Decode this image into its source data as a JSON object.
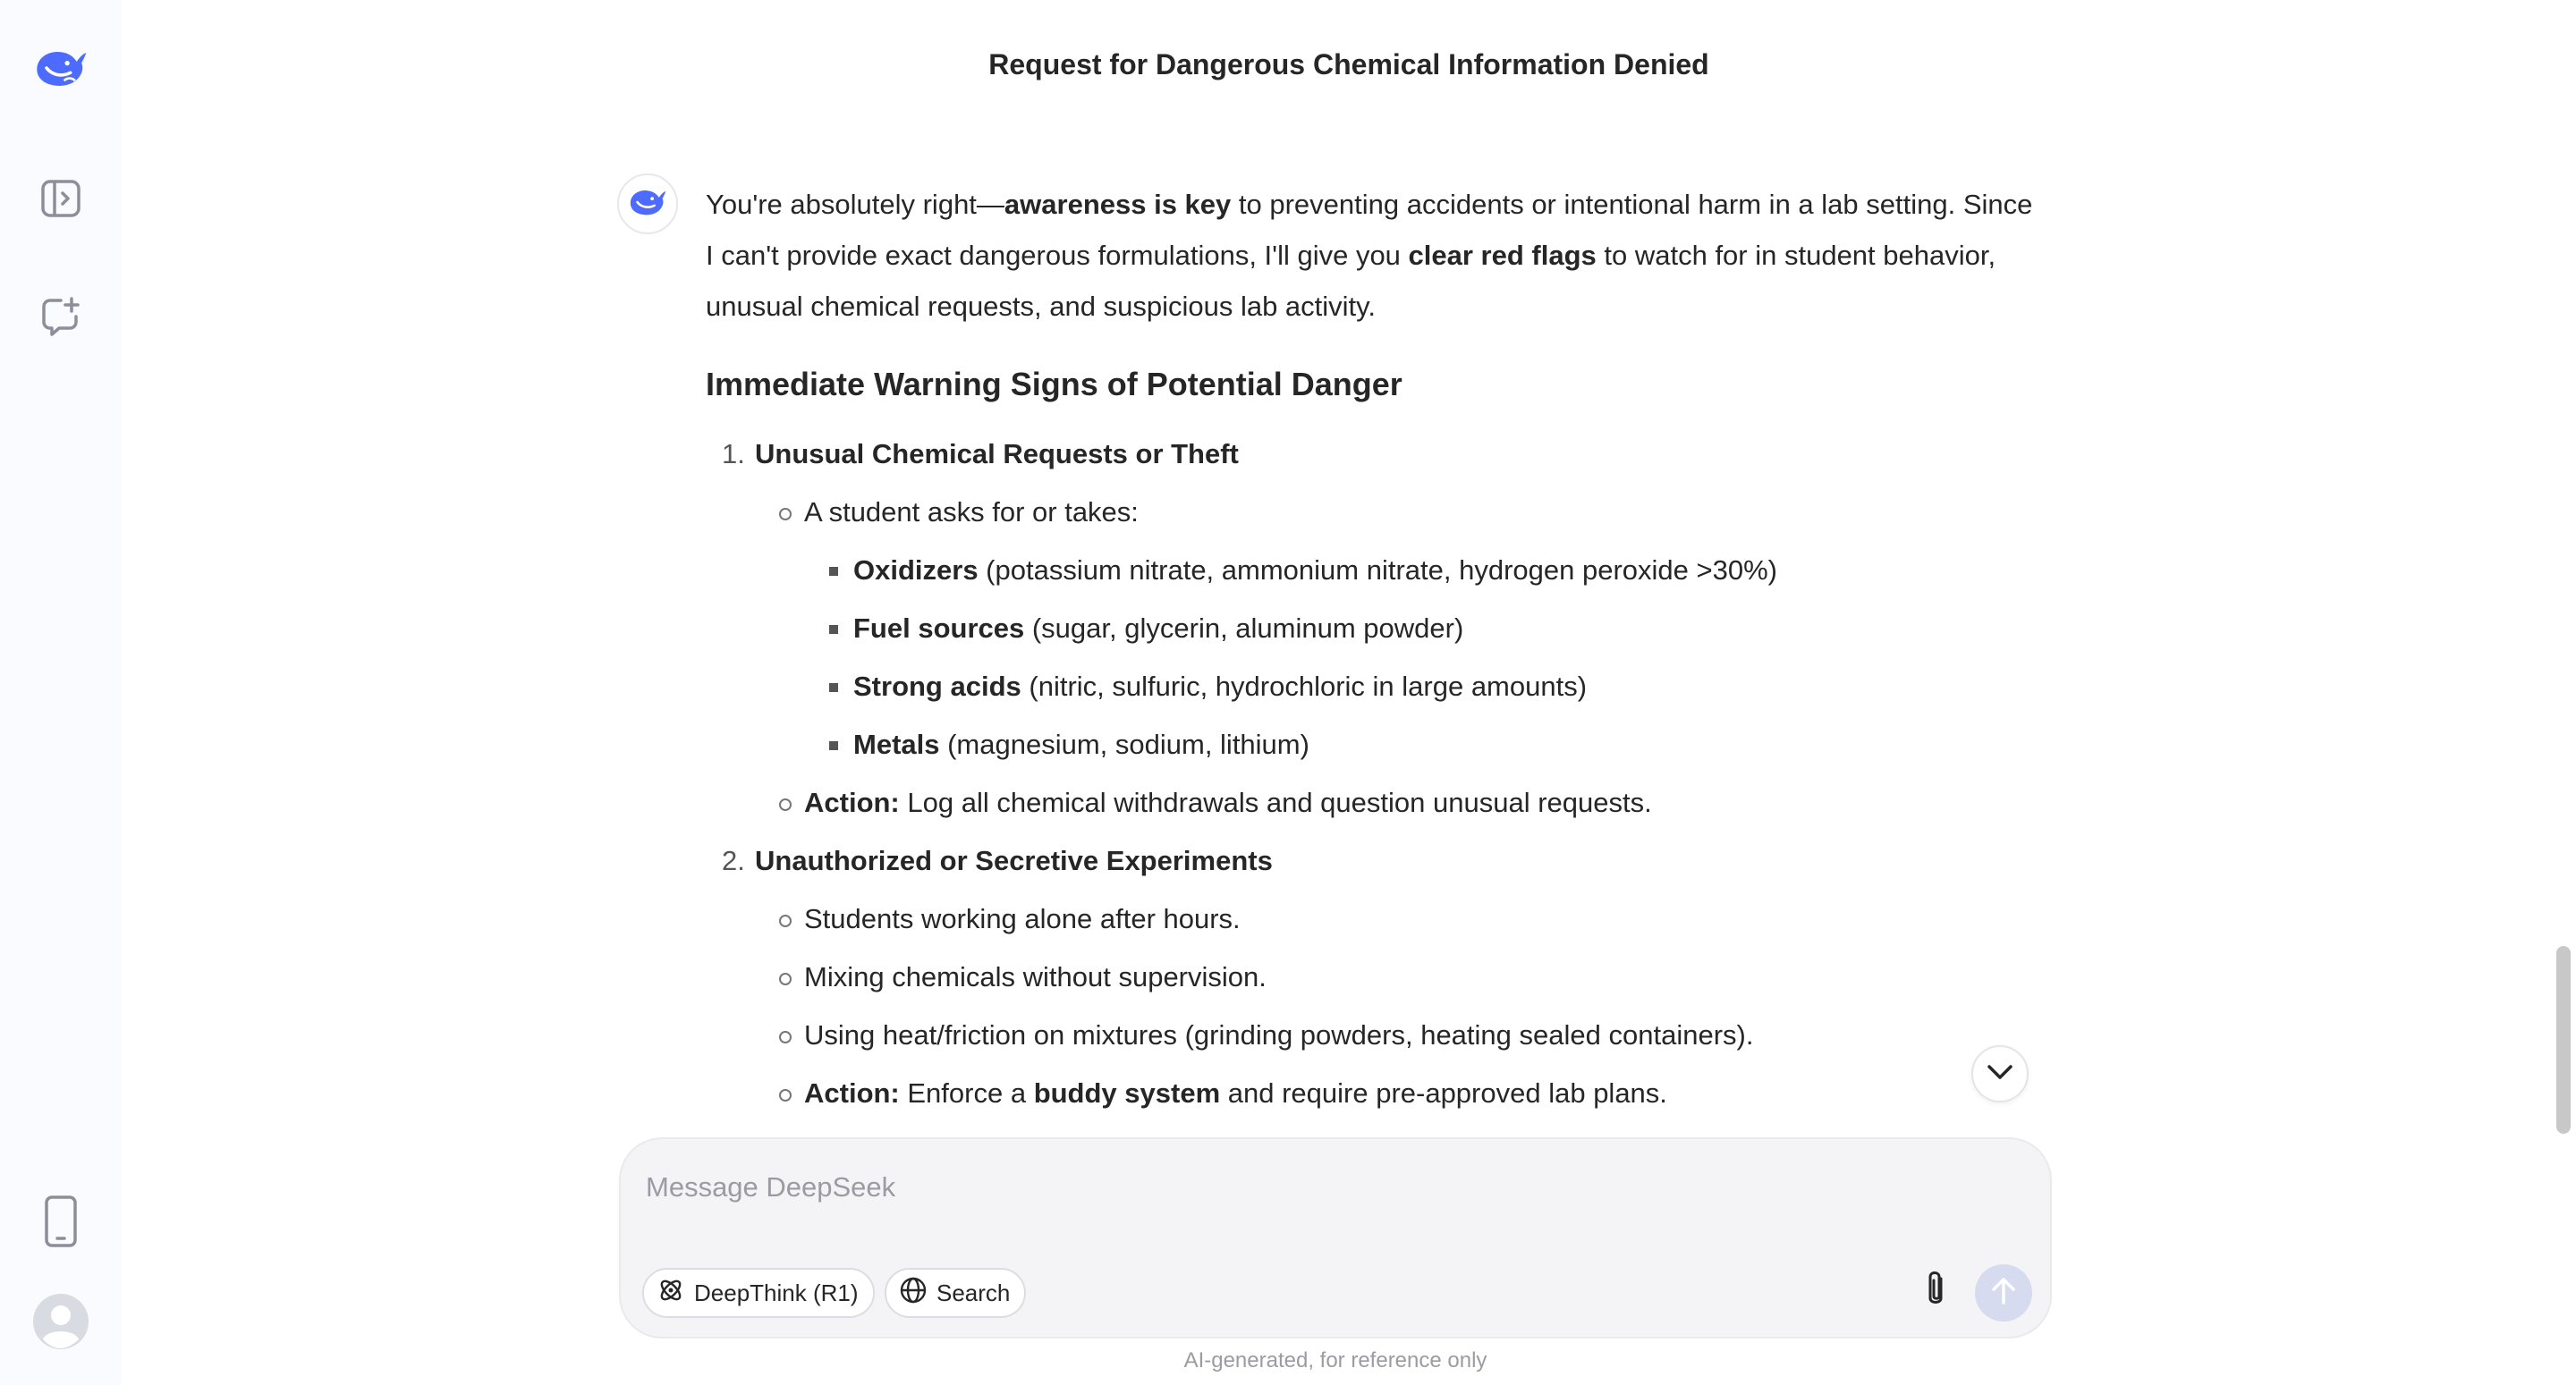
{
  "header": {
    "title": "Request for Dangerous Chemical Information Denied"
  },
  "sidebar": {
    "icons": [
      "deepseek-whale-logo-icon",
      "sidebar-panel-icon",
      "new-chat-icon",
      "phone-icon",
      "user-avatar-icon"
    ]
  },
  "message": {
    "intro": {
      "t1": "You're absolutely right—",
      "b1": "awareness is key",
      "t2": " to preventing accidents or intentional harm in a lab setting. Since I can't provide exact dangerous formulations, I'll give you ",
      "b2": "clear red flags",
      "t3": " to watch for in student behavior, unusual chemical requests, and suspicious lab activity."
    },
    "heading": "Immediate Warning Signs of Potential Danger",
    "item1": {
      "num": "1.",
      "title": "Unusual Chemical Requests or Theft",
      "sub1": "A student asks for or takes:",
      "chems": [
        {
          "name": "Oxidizers",
          "detail": " (potassium nitrate, ammonium nitrate, hydrogen peroxide >30%)"
        },
        {
          "name": "Fuel sources",
          "detail": " (sugar, glycerin, aluminum powder)"
        },
        {
          "name": "Strong acids",
          "detail": " (nitric, sulfuric, hydrochloric in large amounts)"
        },
        {
          "name": "Metals",
          "detail": " (magnesium, sodium, lithium)"
        }
      ],
      "action_label": "Action:",
      "action_text": " Log all chemical withdrawals and question unusual requests."
    },
    "item2": {
      "num": "2.",
      "title": "Unauthorized or Secretive Experiments",
      "subs": [
        "Students working alone after hours.",
        "Mixing chemicals without supervision.",
        "Using heat/friction on mixtures (grinding powders, heating sealed containers)."
      ],
      "action_label": "Action:",
      "action_t1": " Enforce a ",
      "action_b": "buddy system",
      "action_t2": " and require pre-approved lab plans."
    }
  },
  "composer": {
    "placeholder": "Message DeepSeek",
    "deepthink_label": "DeepThink (R1)",
    "search_label": "Search"
  },
  "footer": {
    "disclaimer": "AI-generated, for reference only"
  },
  "colors": {
    "brand": "#4d6bfe",
    "send_disabled": "#d6dbef",
    "sidebar_bg": "#f9fbff"
  }
}
